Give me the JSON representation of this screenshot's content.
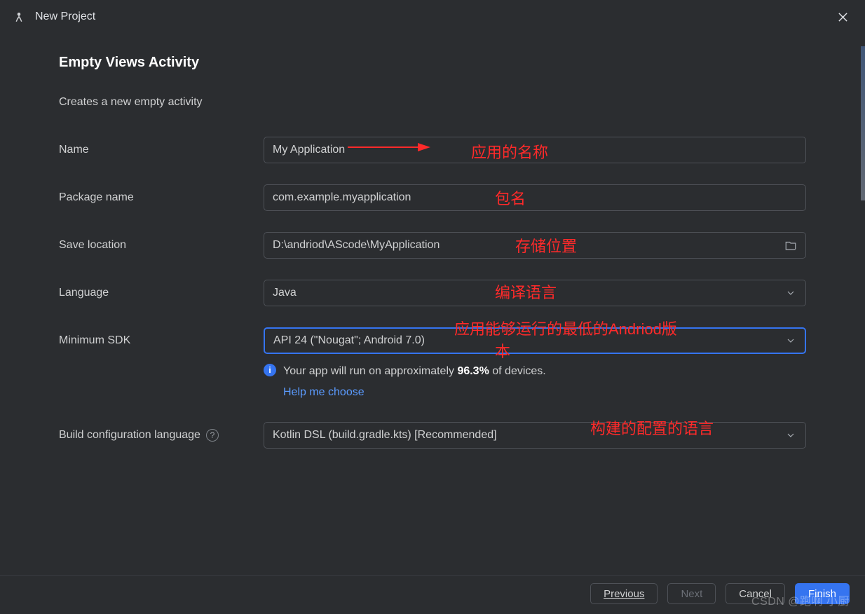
{
  "window": {
    "title": "New Project"
  },
  "page": {
    "heading": "Empty Views Activity",
    "subtitle": "Creates a new empty activity"
  },
  "form": {
    "name": {
      "label": "Name",
      "value": "My Application"
    },
    "package": {
      "label": "Package name",
      "value": "com.example.myapplication"
    },
    "save": {
      "label": "Save location",
      "value": "D:\\andriod\\AScode\\MyApplication"
    },
    "language": {
      "label": "Language",
      "value": "Java"
    },
    "minSdk": {
      "label": "Minimum SDK",
      "value": "API 24 (\"Nougat\"; Android 7.0)"
    },
    "info": {
      "prefix": "Your app will run on approximately ",
      "percent": "96.3%",
      "suffix": " of devices.",
      "help": "Help me choose"
    },
    "buildConfig": {
      "label": "Build configuration language",
      "value": "Kotlin DSL (build.gradle.kts) [Recommended]"
    }
  },
  "footer": {
    "previous": "Previous",
    "next": "Next",
    "cancel": "Cancel",
    "finish": "Finish"
  },
  "annotations": {
    "name": "应用的名称",
    "package": "包名",
    "save": "存储位置",
    "language": "编译语言",
    "minSdk1": "应用能够运行的最低的Andriod版",
    "minSdk2": "本",
    "buildConfig": "构建的配置的语言"
  },
  "watermark": "CSDN @跑啊   小厨"
}
